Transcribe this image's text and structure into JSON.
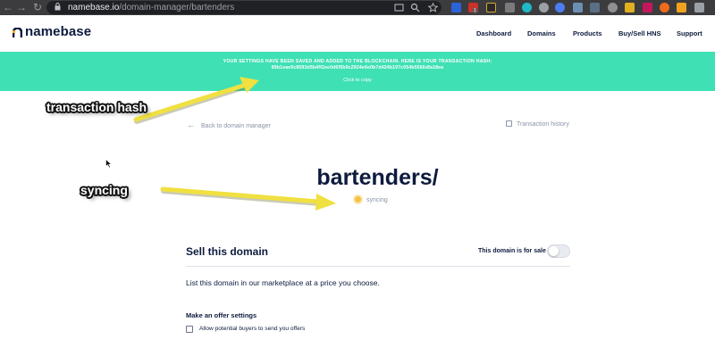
{
  "browser": {
    "url_domain": "namebase.io",
    "url_path": "/domain-manager/bartenders",
    "extension_badge": "1"
  },
  "header": {
    "logo_text": "namebase",
    "nav": [
      "Dashboard",
      "Domains",
      "Products",
      "Buy/Sell HNS",
      "Support"
    ]
  },
  "banner": {
    "message": "YOUR SETTINGS HAVE BEEN SAVED AND ADDED TO THE BLOCKCHAIN. HERE IS YOUR TRANSACTION HASH:",
    "hash": "89b1eae9c8593d5b4ff2ee0d6f5b9c2924e6e0b7d424b197c054b5566dfa18ea",
    "copy_label": "Click to copy",
    "color": "#3fe0b4"
  },
  "annotations": {
    "transaction_hash": "transaction hash",
    "syncing": "syncing",
    "arrow_color": "#f0e040"
  },
  "page": {
    "back_link": "Back to domain manager",
    "history_link": "Transaction history",
    "domain_name": "bartenders/",
    "status": "syncing"
  },
  "sell": {
    "title": "Sell this domain",
    "toggle_label": "This domain is for sale",
    "toggle_on": false,
    "description": "List this domain in our marketplace at a price you choose.",
    "offer_title": "Make an offer settings",
    "offer_checkbox_label": "Allow potential buyers to send you offers",
    "offer_checked": false
  },
  "colors": {
    "primary_text": "#0d1b3e",
    "muted_text": "#8a93a6",
    "syncing_dot": "#f5c243"
  }
}
